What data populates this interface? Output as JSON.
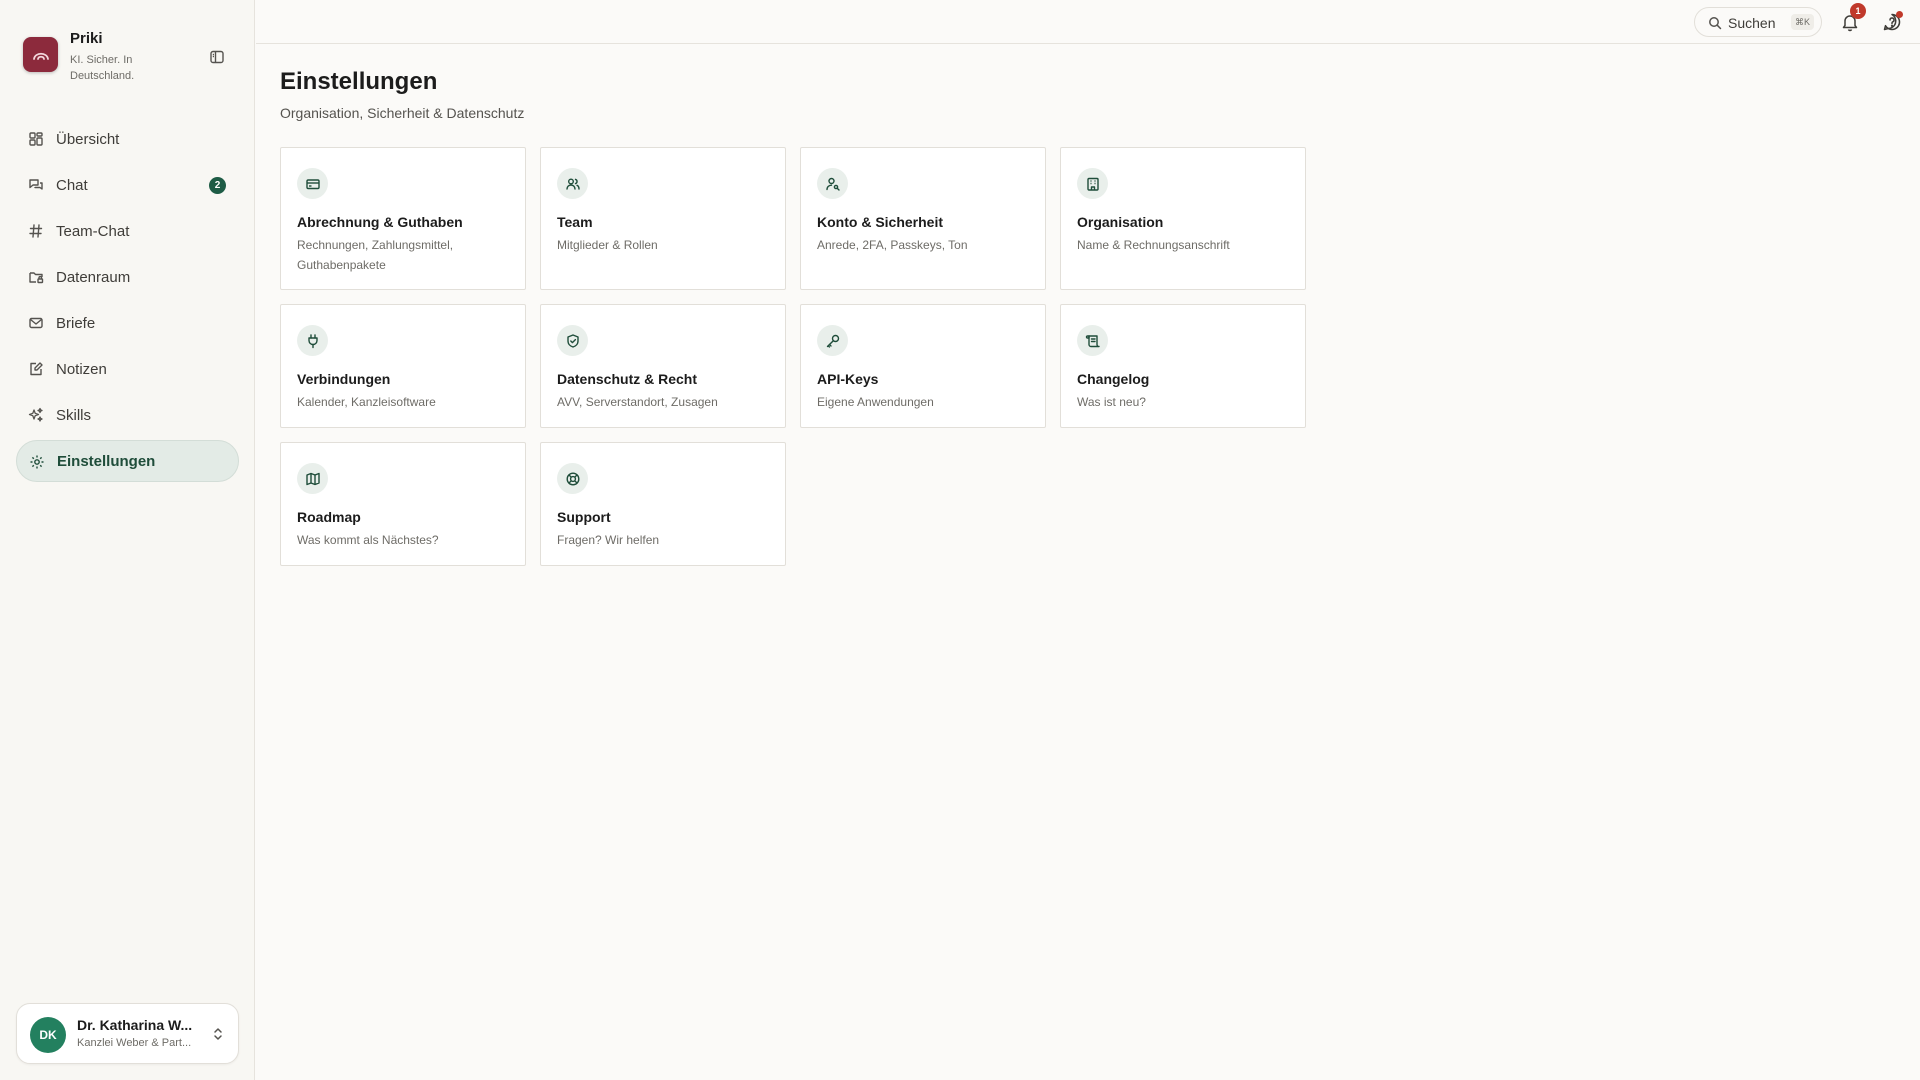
{
  "brand": {
    "name": "Priki",
    "tagline": "KI. Sicher. In Deutschland."
  },
  "nav": {
    "items": [
      {
        "label": "Übersicht",
        "icon": "layout-grid-icon"
      },
      {
        "label": "Chat",
        "icon": "chat-bubbles-icon",
        "badge": "2"
      },
      {
        "label": "Team-Chat",
        "icon": "hash-icon"
      },
      {
        "label": "Datenraum",
        "icon": "folder-lock-icon"
      },
      {
        "label": "Briefe",
        "icon": "mail-icon"
      },
      {
        "label": "Notizen",
        "icon": "note-edit-icon"
      },
      {
        "label": "Skills",
        "icon": "sparkles-icon"
      },
      {
        "label": "Einstellungen",
        "icon": "gear-icon",
        "active": true
      }
    ]
  },
  "user": {
    "initials": "DK",
    "name": "Dr. Katharina W...",
    "org": "Kanzlei Weber & Part..."
  },
  "topbar": {
    "search_label": "Suchen",
    "search_shortcut": "⌘K",
    "notification_count": "1"
  },
  "page": {
    "title": "Einstellungen",
    "subtitle": "Organisation, Sicherheit & Datenschutz"
  },
  "cards": [
    {
      "title": "Abrechnung & Guthaben",
      "desc": "Rechnungen, Zahlungsmittel, Guthabenpakete",
      "icon": "credit-card-icon"
    },
    {
      "title": "Team",
      "desc": "Mitglieder & Rollen",
      "icon": "users-icon"
    },
    {
      "title": "Konto & Sicherheit",
      "desc": "Anrede, 2FA, Passkeys, Ton",
      "icon": "user-key-icon"
    },
    {
      "title": "Organisation",
      "desc": "Name & Rechnungsanschrift",
      "icon": "building-icon"
    },
    {
      "title": "Verbindungen",
      "desc": "Kalender, Kanzleisoftware",
      "icon": "plug-icon"
    },
    {
      "title": "Datenschutz & Recht",
      "desc": "AVV, Serverstandort, Zusagen",
      "icon": "shield-check-icon"
    },
    {
      "title": "API-Keys",
      "desc": "Eigene Anwendungen",
      "icon": "key-icon"
    },
    {
      "title": "Changelog",
      "desc": "Was ist neu?",
      "icon": "scroll-icon"
    },
    {
      "title": "Roadmap",
      "desc": "Was kommt als Nächstes?",
      "icon": "map-icon"
    },
    {
      "title": "Support",
      "desc": "Fragen? Wir helfen",
      "icon": "life-buoy-icon"
    }
  ],
  "colors": {
    "accent": "#1f4d3a",
    "brand": "#8c2a3c",
    "badge": "#1e5c45",
    "alert": "#c0392b"
  }
}
